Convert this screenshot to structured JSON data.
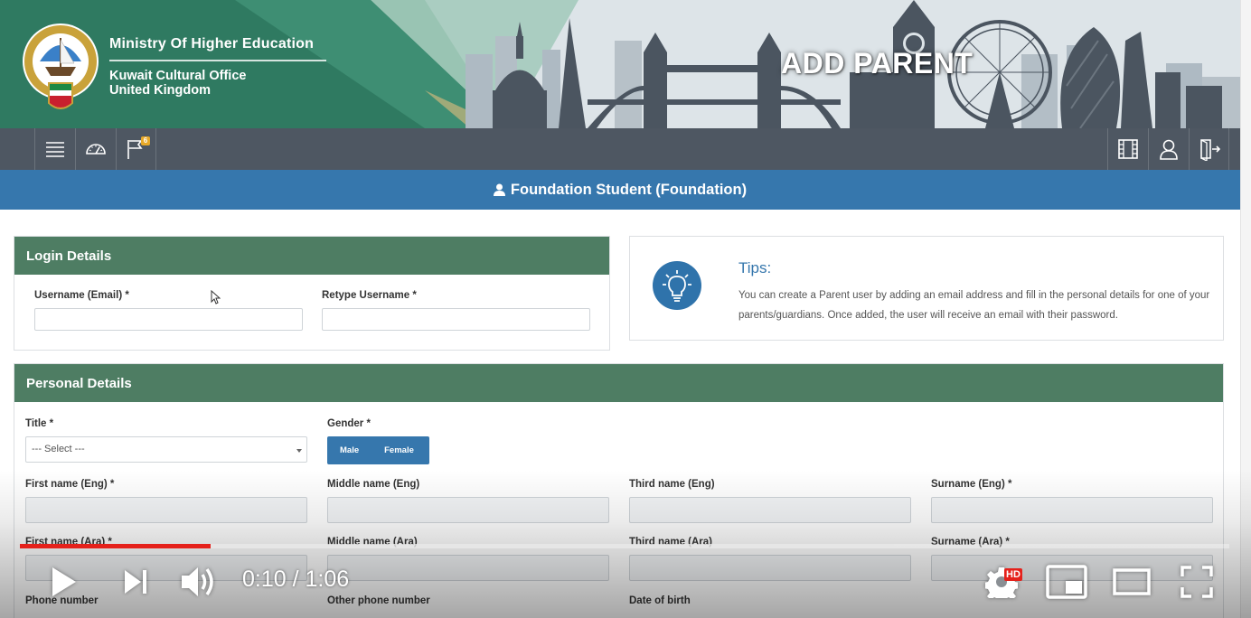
{
  "banner": {
    "org_name": "Ministry Of Higher Education",
    "org_sub_line1": "Kuwait Cultural Office",
    "org_sub_line2": "United Kingdom",
    "page_heading": "ADD PARENT"
  },
  "toolbar": {
    "left_icons": [
      "menu-icon",
      "dashboard-gauge-icon",
      "flag-icon"
    ],
    "flag_badge": "6",
    "right_icons": [
      "film-icon",
      "user-icon",
      "logout-icon"
    ]
  },
  "titlebar": {
    "icon": "user-icon",
    "text": "Foundation Student (Foundation)"
  },
  "login_details": {
    "heading": "Login Details",
    "username_label": "Username (Email)  *",
    "retype_label": "Retype Username  *",
    "username_value": "",
    "retype_value": ""
  },
  "tips": {
    "icon": "lightbulb-icon",
    "title": "Tips:",
    "text": "You can create a Parent user by adding an email address and fill in the personal details for one of your parents/guardians. Once added, the user will receive an email with their password."
  },
  "personal_details": {
    "heading": "Personal Details",
    "title_label": "Title  *",
    "title_selected": "--- Select ---",
    "gender_label": "Gender  *",
    "gender_options": [
      "Male",
      "Female"
    ],
    "first_eng": "First name (Eng)  *",
    "middle_eng": "Middle name (Eng)",
    "third_eng": "Third name (Eng)",
    "surname_eng": "Surname (Eng)  *",
    "first_ara": "First name (Ara)  *",
    "middle_ara": "Middle name (Ara)",
    "third_ara": "Third name (Ara)",
    "surname_ara": "Surname (Ara)  *",
    "phone": "Phone number",
    "other_phone": "Other phone number",
    "dob": "Date of birth"
  },
  "video": {
    "time_current": "0:10",
    "time_separator": "/",
    "time_total": "1:06",
    "played_fraction": 0.158,
    "buffered_fraction": 0.723,
    "quality_badge": "HD",
    "accent": "#e5211b"
  },
  "colors": {
    "toolbar": "#4e5762",
    "titlebar": "#3677ad",
    "panel_header": "#4e7d63",
    "banner_green": "#2f7a61"
  }
}
